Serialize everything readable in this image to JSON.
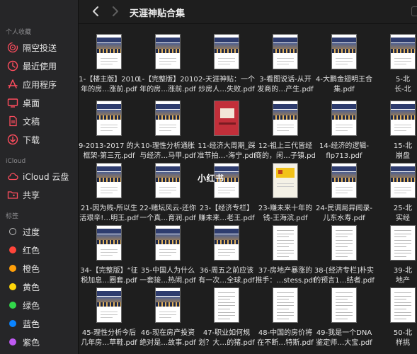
{
  "window": {
    "title": "天涯神贴合集"
  },
  "sidebar": {
    "favorites_title": "个人收藏",
    "favorites": [
      {
        "label": "隔空投送",
        "icon": "airdrop-icon"
      },
      {
        "label": "最近使用",
        "icon": "clock-icon"
      },
      {
        "label": "应用程序",
        "icon": "applications-icon"
      },
      {
        "label": "桌面",
        "icon": "desktop-icon"
      },
      {
        "label": "文稿",
        "icon": "document-icon"
      },
      {
        "label": "下载",
        "icon": "download-icon"
      }
    ],
    "icloud_title": "iCloud",
    "icloud": [
      {
        "label": "iCloud 云盘",
        "icon": "cloud-icon"
      },
      {
        "label": "共享",
        "icon": "shared-folder-icon"
      }
    ],
    "tags_title": "标签",
    "tags": [
      {
        "label": "过度",
        "color": ""
      },
      {
        "label": "红色",
        "color": "#ff453a"
      },
      {
        "label": "橙色",
        "color": "#ff9f0a"
      },
      {
        "label": "黄色",
        "color": "#ffd60a"
      },
      {
        "label": "绿色",
        "color": "#32d74b"
      },
      {
        "label": "蓝色",
        "color": "#0a84ff"
      },
      {
        "label": "紫色",
        "color": "#bf5af2"
      }
    ]
  },
  "watermark": "小红书",
  "files": [
    [
      {
        "l1": "1-【楼主版】2010",
        "l2": "年的房…涨前.pdf",
        "style": "city"
      },
      {
        "l1": "1-【完整版】2010",
        "l2": "年的房…涨前.pdf",
        "style": "city"
      },
      {
        "l1": "2-天涯神贴：一个",
        "l2": "炒房人…失败.pdf",
        "style": "city"
      },
      {
        "l1": "3-看图说话-从开",
        "l2": "发商的…产生.pdf",
        "style": "city"
      },
      {
        "l1": "4-大鹏金翅明王合",
        "l2": "集.pdf",
        "style": "city"
      },
      {
        "l1": "5-北",
        "l2": "长-北",
        "style": "city"
      }
    ],
    [
      {
        "l1": "9-2013-2017 的大",
        "l2": "框架-第三元.pdf",
        "style": "city"
      },
      {
        "l1": "10-理性分析通胀",
        "l2": "与经济…马甲.pdf",
        "style": "city"
      },
      {
        "l1": "11-经济大周期_踩",
        "l2": "准节拍…-海宁.pdf",
        "style": "red"
      },
      {
        "l1": "12-祖上三代皆经",
        "l2": "商的，闲…子镇.pdf",
        "style": "city"
      },
      {
        "l1": "14-经济的逻辑-",
        "l2": "flp713.pdf",
        "style": "city"
      },
      {
        "l1": "15-北",
        "l2": "崩盘",
        "style": "city"
      }
    ],
    [
      {
        "l1": "21-因为贱-所以生",
        "l2": "活艰辛!…明王.pdf",
        "style": "city"
      },
      {
        "l1": "22-赌坛风云-还你",
        "l2": "一个真…育润.pdf",
        "style": "city"
      },
      {
        "l1": "23-【经济专栏】",
        "l2": "赚未来…老王.pdf",
        "style": "city"
      },
      {
        "l1": "23-赚未来十年的",
        "l2": "钱-王海滨.pdf",
        "style": "yellow"
      },
      {
        "l1": "24-民调局异闻录-",
        "l2": "儿东水寿.pdf",
        "style": "city"
      },
      {
        "l1": "25-北",
        "l2": "实经",
        "style": "city"
      }
    ],
    [
      {
        "l1": "34-【完整版】“征",
        "l2": "税加息…圈套.pdf",
        "style": "city"
      },
      {
        "l1": "35-中国人为什么",
        "l2": "一套接…热闹.pdf",
        "style": "city"
      },
      {
        "l1": "36-周五之前应该",
        "l2": "有一次…全球.pdf",
        "style": "city"
      },
      {
        "l1": "37-房地产暴涨的",
        "l2": "推手：…stess.pdf",
        "style": "text"
      },
      {
        "l1": "38-[经济专栏]朴实",
        "l2": "的预言1…结者.pdf",
        "style": "text"
      },
      {
        "l1": "39-北",
        "l2": "地产",
        "style": "text"
      }
    ],
    [
      {
        "l1": "45-理性分析今后",
        "l2": "几年房…草鞋.pdf",
        "style": "city"
      },
      {
        "l1": "46-现在房产投资",
        "l2": "绝对是…故事.pdf",
        "style": "city"
      },
      {
        "l1": "47-职业如何规",
        "l2": "划？大…的猪.pdf",
        "style": "text"
      },
      {
        "l1": "48-中国的房价将",
        "l2": "在不断…特斯.pdf",
        "style": "text"
      },
      {
        "l1": "49-我是一个DNA",
        "l2": "鉴定师…大宝.pdf",
        "style": "text"
      },
      {
        "l1": "50-北",
        "l2": "样挑",
        "style": "text"
      }
    ]
  ]
}
